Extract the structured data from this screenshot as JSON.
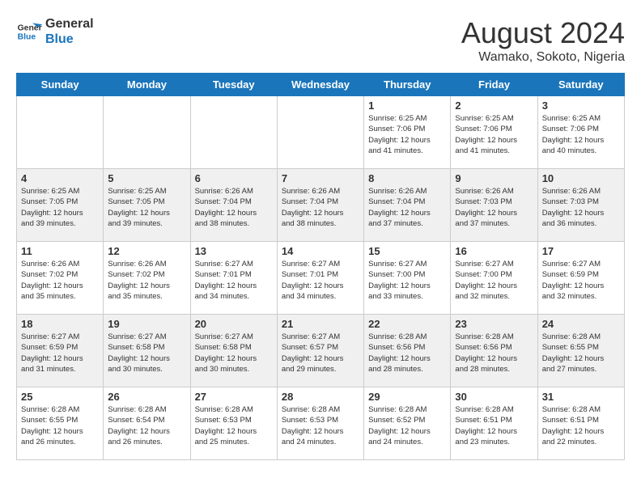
{
  "header": {
    "logo_line1": "General",
    "logo_line2": "Blue",
    "month_year": "August 2024",
    "location": "Wamako, Sokoto, Nigeria"
  },
  "days_of_week": [
    "Sunday",
    "Monday",
    "Tuesday",
    "Wednesday",
    "Thursday",
    "Friday",
    "Saturday"
  ],
  "weeks": [
    {
      "days": [
        {
          "number": "",
          "info": ""
        },
        {
          "number": "",
          "info": ""
        },
        {
          "number": "",
          "info": ""
        },
        {
          "number": "",
          "info": ""
        },
        {
          "number": "1",
          "info": "Sunrise: 6:25 AM\nSunset: 7:06 PM\nDaylight: 12 hours\nand 41 minutes."
        },
        {
          "number": "2",
          "info": "Sunrise: 6:25 AM\nSunset: 7:06 PM\nDaylight: 12 hours\nand 41 minutes."
        },
        {
          "number": "3",
          "info": "Sunrise: 6:25 AM\nSunset: 7:06 PM\nDaylight: 12 hours\nand 40 minutes."
        }
      ]
    },
    {
      "days": [
        {
          "number": "4",
          "info": "Sunrise: 6:25 AM\nSunset: 7:05 PM\nDaylight: 12 hours\nand 39 minutes."
        },
        {
          "number": "5",
          "info": "Sunrise: 6:25 AM\nSunset: 7:05 PM\nDaylight: 12 hours\nand 39 minutes."
        },
        {
          "number": "6",
          "info": "Sunrise: 6:26 AM\nSunset: 7:04 PM\nDaylight: 12 hours\nand 38 minutes."
        },
        {
          "number": "7",
          "info": "Sunrise: 6:26 AM\nSunset: 7:04 PM\nDaylight: 12 hours\nand 38 minutes."
        },
        {
          "number": "8",
          "info": "Sunrise: 6:26 AM\nSunset: 7:04 PM\nDaylight: 12 hours\nand 37 minutes."
        },
        {
          "number": "9",
          "info": "Sunrise: 6:26 AM\nSunset: 7:03 PM\nDaylight: 12 hours\nand 37 minutes."
        },
        {
          "number": "10",
          "info": "Sunrise: 6:26 AM\nSunset: 7:03 PM\nDaylight: 12 hours\nand 36 minutes."
        }
      ]
    },
    {
      "days": [
        {
          "number": "11",
          "info": "Sunrise: 6:26 AM\nSunset: 7:02 PM\nDaylight: 12 hours\nand 35 minutes."
        },
        {
          "number": "12",
          "info": "Sunrise: 6:26 AM\nSunset: 7:02 PM\nDaylight: 12 hours\nand 35 minutes."
        },
        {
          "number": "13",
          "info": "Sunrise: 6:27 AM\nSunset: 7:01 PM\nDaylight: 12 hours\nand 34 minutes."
        },
        {
          "number": "14",
          "info": "Sunrise: 6:27 AM\nSunset: 7:01 PM\nDaylight: 12 hours\nand 34 minutes."
        },
        {
          "number": "15",
          "info": "Sunrise: 6:27 AM\nSunset: 7:00 PM\nDaylight: 12 hours\nand 33 minutes."
        },
        {
          "number": "16",
          "info": "Sunrise: 6:27 AM\nSunset: 7:00 PM\nDaylight: 12 hours\nand 32 minutes."
        },
        {
          "number": "17",
          "info": "Sunrise: 6:27 AM\nSunset: 6:59 PM\nDaylight: 12 hours\nand 32 minutes."
        }
      ]
    },
    {
      "days": [
        {
          "number": "18",
          "info": "Sunrise: 6:27 AM\nSunset: 6:59 PM\nDaylight: 12 hours\nand 31 minutes."
        },
        {
          "number": "19",
          "info": "Sunrise: 6:27 AM\nSunset: 6:58 PM\nDaylight: 12 hours\nand 30 minutes."
        },
        {
          "number": "20",
          "info": "Sunrise: 6:27 AM\nSunset: 6:58 PM\nDaylight: 12 hours\nand 30 minutes."
        },
        {
          "number": "21",
          "info": "Sunrise: 6:27 AM\nSunset: 6:57 PM\nDaylight: 12 hours\nand 29 minutes."
        },
        {
          "number": "22",
          "info": "Sunrise: 6:28 AM\nSunset: 6:56 PM\nDaylight: 12 hours\nand 28 minutes."
        },
        {
          "number": "23",
          "info": "Sunrise: 6:28 AM\nSunset: 6:56 PM\nDaylight: 12 hours\nand 28 minutes."
        },
        {
          "number": "24",
          "info": "Sunrise: 6:28 AM\nSunset: 6:55 PM\nDaylight: 12 hours\nand 27 minutes."
        }
      ]
    },
    {
      "days": [
        {
          "number": "25",
          "info": "Sunrise: 6:28 AM\nSunset: 6:55 PM\nDaylight: 12 hours\nand 26 minutes."
        },
        {
          "number": "26",
          "info": "Sunrise: 6:28 AM\nSunset: 6:54 PM\nDaylight: 12 hours\nand 26 minutes."
        },
        {
          "number": "27",
          "info": "Sunrise: 6:28 AM\nSunset: 6:53 PM\nDaylight: 12 hours\nand 25 minutes."
        },
        {
          "number": "28",
          "info": "Sunrise: 6:28 AM\nSunset: 6:53 PM\nDaylight: 12 hours\nand 24 minutes."
        },
        {
          "number": "29",
          "info": "Sunrise: 6:28 AM\nSunset: 6:52 PM\nDaylight: 12 hours\nand 24 minutes."
        },
        {
          "number": "30",
          "info": "Sunrise: 6:28 AM\nSunset: 6:51 PM\nDaylight: 12 hours\nand 23 minutes."
        },
        {
          "number": "31",
          "info": "Sunrise: 6:28 AM\nSunset: 6:51 PM\nDaylight: 12 hours\nand 22 minutes."
        }
      ]
    }
  ]
}
